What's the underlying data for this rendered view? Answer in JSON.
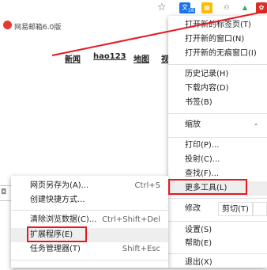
{
  "bookmark": {
    "title": "网易邮箱6.0版"
  },
  "nav_links": [
    "新闻",
    "hao123",
    "地图",
    "视"
  ],
  "extensions": [
    {
      "icon": "translate-extension-icon",
      "color": "#1a73e8"
    },
    {
      "icon": "colorful-extension-icon",
      "color": "#fbbc04"
    },
    {
      "icon": "link-extension-icon",
      "color": "#5f6368"
    },
    {
      "icon": "chart-extension-icon",
      "color": "#34a853"
    },
    {
      "icon": "abp-extension-icon",
      "color": "#d93025"
    }
  ],
  "ext_badge": "28",
  "main_menu": {
    "new_tab": "打开新的标签页(T)",
    "new_window": "打开新的窗口(N)",
    "new_incognito": "打开新的无痕窗口(I)",
    "history": "历史记录(H)",
    "downloads": "下载内容(D)",
    "bookmarks": "书签(B)",
    "zoom_label": "缩放",
    "zoom_minus": "-",
    "print": "打印(P)...",
    "cast": "投射(C)...",
    "find": "查找(F)...",
    "more_tools": "更多工具(L)",
    "edit_label": "修改",
    "cut": "剪切(T)",
    "settings": "设置(S)",
    "help": "帮助(E)",
    "exit": "退出(X)"
  },
  "sub_menu": {
    "save_page": "网页另存为(A)...",
    "save_page_shortcut": "Ctrl+S",
    "create_shortcut": "创建快捷方式...",
    "clear_data": "清除浏览数据(C)...",
    "clear_data_shortcut": "Ctrl+Shift+Del",
    "extensions": "扩展程序(E)",
    "task_manager": "任务管理器(T)",
    "task_manager_shortcut": "Shift+Esc"
  },
  "colors": {
    "annotation_red": "#e8171f",
    "menu_bg": "#ffffff"
  }
}
